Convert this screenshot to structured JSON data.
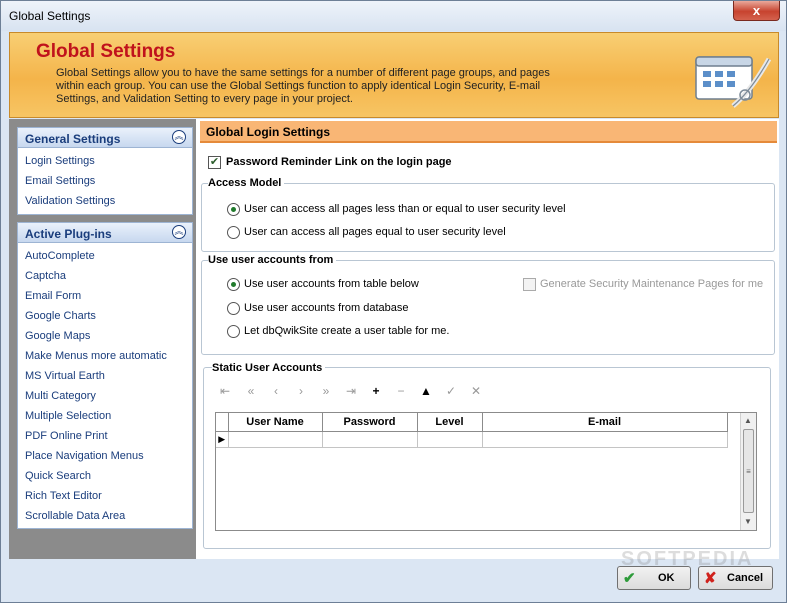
{
  "window": {
    "title": "Global Settings",
    "close_glyph": "x"
  },
  "header": {
    "title": "Global Settings",
    "description": "Global Settings allow you to have the same settings for a number of different page groups, and pages within each group.  You can use the Global Settings function to apply identical Login Security, E-mail Settings, and Validation Setting to every page in your project."
  },
  "sidebar": {
    "general": {
      "title": "General Settings",
      "items": [
        {
          "label": "Login Settings"
        },
        {
          "label": "Email Settings"
        },
        {
          "label": "Validation Settings"
        }
      ]
    },
    "plugins": {
      "title": "Active Plug-ins",
      "items": [
        {
          "label": "AutoComplete"
        },
        {
          "label": "Captcha"
        },
        {
          "label": "Email Form"
        },
        {
          "label": "Google Charts"
        },
        {
          "label": "Google Maps"
        },
        {
          "label": "Make Menus more automatic"
        },
        {
          "label": "MS Virtual Earth"
        },
        {
          "label": "Multi Category"
        },
        {
          "label": "Multiple Selection"
        },
        {
          "label": "PDF Online Print"
        },
        {
          "label": "Place Navigation Menus"
        },
        {
          "label": "Quick Search"
        },
        {
          "label": "Rich Text Editor"
        },
        {
          "label": "Scrollable Data Area"
        }
      ]
    }
  },
  "main": {
    "title": "Global Login Settings",
    "password_reminder": {
      "label": "Password Reminder Link on the login page",
      "checked": true
    },
    "access_model": {
      "legend": "Access Model",
      "options": [
        {
          "label": "User can access all pages less than or equal to user security level",
          "selected": true
        },
        {
          "label": "User can access all pages equal to user security level",
          "selected": false
        }
      ]
    },
    "user_accounts": {
      "legend": "Use user accounts from",
      "options": [
        {
          "label": "Use user accounts from table below",
          "selected": true
        },
        {
          "label": "Use user accounts from database",
          "selected": false
        },
        {
          "label": "Let dbQwikSite create a user table for me.",
          "selected": false
        }
      ],
      "generate_pages": {
        "label": "Generate Security Maintenance Pages for me",
        "checked": false,
        "enabled": false
      }
    },
    "static_accounts": {
      "legend": "Static User Accounts",
      "columns": [
        "User Name",
        "Password",
        "Level",
        "E-mail"
      ],
      "row_indicator": "▶"
    }
  },
  "buttons": {
    "ok": "OK",
    "cancel": "Cancel"
  },
  "watermark": "SOFTPEDIA",
  "colors": {
    "title_red": "#c0121c",
    "header_orange": "#f4b44a",
    "link_blue": "#1a3d7c",
    "accent_green": "#207a2c"
  }
}
